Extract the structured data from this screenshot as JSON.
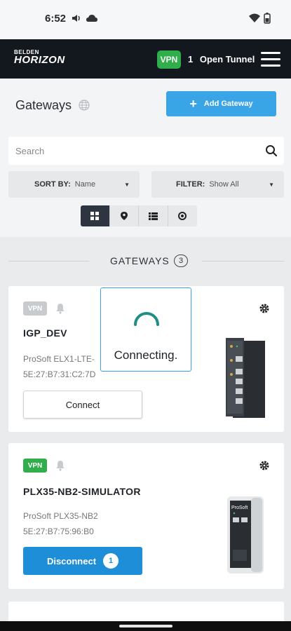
{
  "status_bar": {
    "time": "6:52"
  },
  "header": {
    "logo_line1": "BELDEN",
    "logo_line2": "HORIZON",
    "vpn_badge": "VPN",
    "tunnel_count": "1",
    "tunnel_label": "Open Tunnel"
  },
  "toolbar": {
    "title": "Gateways",
    "add_label": "Add Gateway",
    "search_placeholder": "Search",
    "sort_label": "SORT BY:",
    "sort_value": "Name",
    "filter_label": "FILTER:",
    "filter_value": "Show All"
  },
  "section": {
    "title": "GATEWAYS",
    "count": "3"
  },
  "gateways": [
    {
      "vpn": "VPN",
      "name": "IGP_DEV",
      "model": "ProSoft ELX1-LTE-",
      "mac": "5E:27:B7:31:C2:7D",
      "action": "Connect"
    },
    {
      "vpn": "VPN",
      "name": "PLX35-NB2-SIMULATOR",
      "model": "ProSoft PLX35-NB2",
      "mac": "5E:27:B7:75:96:B0",
      "action": "Disconnect",
      "action_count": "1"
    }
  ],
  "overlay": {
    "text": "Connecting."
  },
  "colors": {
    "vpn_active": "#2fae4b",
    "vpn_inactive": "#c8cbce",
    "primary": "#3aa5e6",
    "disconnect": "#1f8ed8",
    "appbar": "#13181f"
  }
}
